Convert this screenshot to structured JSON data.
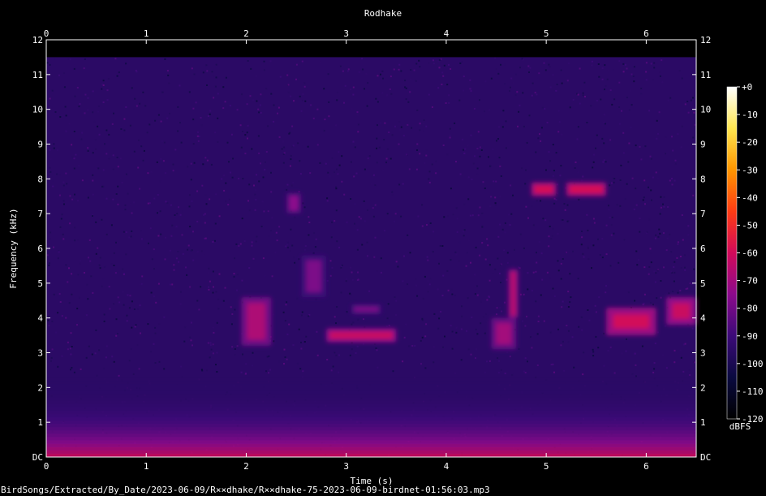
{
  "chart_data": {
    "type": "heatmap",
    "title": "Rodhake",
    "xlabel": "Time (s)",
    "ylabel": "Frequency (kHz)",
    "xlim": [
      0,
      6.5
    ],
    "ylim": [
      0,
      12
    ],
    "x_ticks": [
      "0",
      "1",
      "2",
      "3",
      "4",
      "5",
      "6"
    ],
    "y_ticks": [
      "DC",
      "1",
      "2",
      "3",
      "4",
      "5",
      "6",
      "7",
      "8",
      "9",
      "10",
      "11",
      "12"
    ],
    "spectrum_top_khz": 11.5,
    "colorbar": {
      "label": "dBFS",
      "range": [
        -120,
        0
      ],
      "ticks": [
        "+0",
        "-10",
        "-20",
        "-30",
        "-40",
        "-50",
        "-60",
        "-70",
        "-80",
        "-90",
        "-100",
        "-110",
        "-120"
      ],
      "colors": [
        "#000000",
        "#0a0a40",
        "#3c0a78",
        "#8c0a8c",
        "#d20a5a",
        "#ff3c14",
        "#ff9600",
        "#ffe650",
        "#ffffff"
      ]
    },
    "background_level_dbfs": -95,
    "low_frequency_band": {
      "level_dbfs": -60,
      "from_khz": 0,
      "to_khz": 2.3
    },
    "calls": [
      {
        "t0": 1.95,
        "t1": 2.25,
        "f0": 3.2,
        "f1": 4.6,
        "level_dbfs": -68
      },
      {
        "t0": 2.4,
        "t1": 2.55,
        "f0": 7.0,
        "f1": 7.6,
        "level_dbfs": -75
      },
      {
        "t0": 2.55,
        "t1": 2.8,
        "f0": 4.6,
        "f1": 5.8,
        "level_dbfs": -78
      },
      {
        "t0": 2.8,
        "t1": 3.5,
        "f0": 3.3,
        "f1": 3.7,
        "level_dbfs": -62
      },
      {
        "t0": 3.05,
        "t1": 3.35,
        "f0": 4.1,
        "f1": 4.4,
        "level_dbfs": -78
      },
      {
        "t0": 4.45,
        "t1": 4.7,
        "f0": 3.1,
        "f1": 4.0,
        "level_dbfs": -70
      },
      {
        "t0": 4.62,
        "t1": 4.72,
        "f0": 4.0,
        "f1": 5.4,
        "level_dbfs": -66
      },
      {
        "t0": 4.85,
        "t1": 5.1,
        "f0": 7.5,
        "f1": 7.9,
        "level_dbfs": -58
      },
      {
        "t0": 5.2,
        "t1": 5.6,
        "f0": 7.5,
        "f1": 7.9,
        "level_dbfs": -58
      },
      {
        "t0": 5.6,
        "t1": 6.1,
        "f0": 3.5,
        "f1": 4.3,
        "level_dbfs": -60
      },
      {
        "t0": 6.2,
        "t1": 6.5,
        "f0": 3.8,
        "f1": 4.6,
        "level_dbfs": -62
      }
    ]
  },
  "footer": {
    "filename": "BirdSongs/Extracted/By_Date/2023-06-09/R××dhake/R××dhake-75-2023-06-09-birdnet-01:56:03.mp3"
  }
}
